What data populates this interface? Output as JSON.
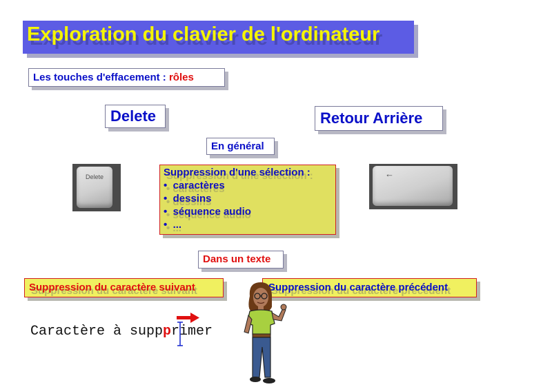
{
  "title": "Exploration du clavier de l'ordinateur",
  "subtitle": {
    "prefix": "Les touches d'effacement :",
    "highlight": "rôles"
  },
  "keys": {
    "delete": "Delete",
    "backspace": "Retour Arrière",
    "delete_cap": "Delete",
    "backspace_cap": "←"
  },
  "general": {
    "label": "En général",
    "heading": "Suppression d'une sélection :",
    "items": [
      "caractères",
      "dessins",
      "séquence audio",
      "..."
    ]
  },
  "in_text": {
    "label": "Dans un texte",
    "next_char": "Suppression du caractère suivant",
    "prev_char": "Suppression du caractère précédent"
  },
  "example": {
    "before": "Caractère à supp",
    "target": "p",
    "after": "rimer"
  },
  "colors": {
    "title_bg": "#5c5ce4",
    "title_text": "#f5f500",
    "blue_text": "#0a10c8",
    "red_text": "#e01010",
    "yellow_box": "#e0e060"
  }
}
